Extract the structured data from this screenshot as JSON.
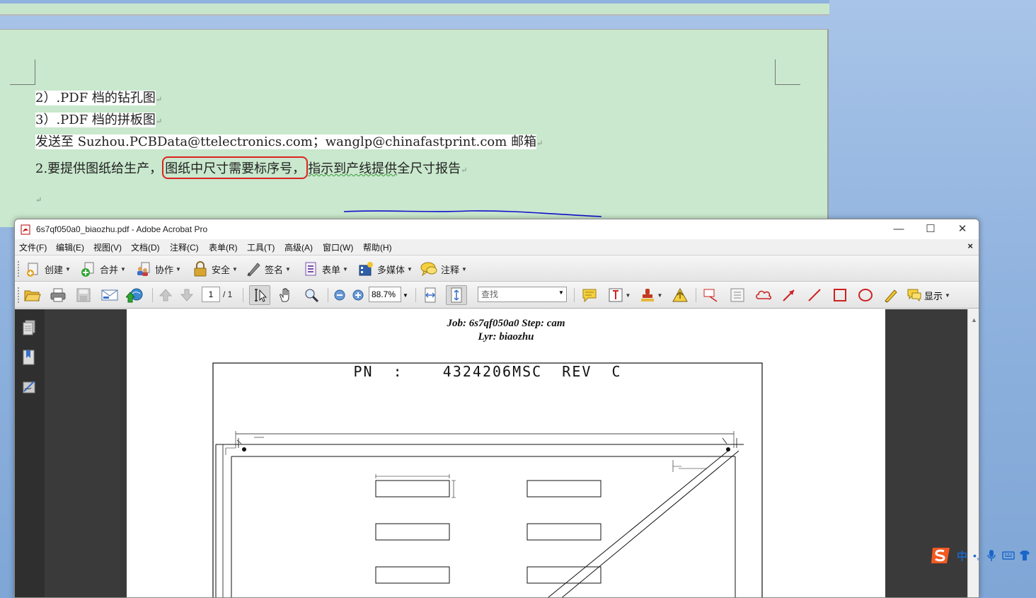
{
  "document": {
    "line1": "2）.PDF 档的钻孔图",
    "line2": "3）.PDF 档的拼板图",
    "line3": "发送至 Suzhou.PCBData@ttelectronics.com；wanglp@chinafastprint.com 邮箱",
    "line4_prefix": "2.要提供图纸给生产，",
    "line4_circled": "图纸中尺寸需要标序号，",
    "line4_underlined": "指示到产线提供",
    "line4_rest": "全尺寸报告",
    "paragraph_mark": "↵"
  },
  "acrobat": {
    "title": "6s7qf050a0_biaozhu.pdf - Adobe Acrobat Pro",
    "window_controls": {
      "minimize": "—",
      "maximize": "☐",
      "close": "✕"
    },
    "menu": [
      "文件(F)",
      "编辑(E)",
      "视图(V)",
      "文档(D)",
      "注释(C)",
      "表单(R)",
      "工具(T)",
      "高级(A)",
      "窗口(W)",
      "帮助(H)"
    ],
    "menu_close": "×",
    "toolbar1": [
      "创建",
      "合并",
      "协作",
      "安全",
      "签名",
      "表单",
      "多媒体",
      "注释"
    ],
    "toolbar2": {
      "page_current": "1",
      "page_total": "/ 1",
      "zoom": "88.7%",
      "find_placeholder": "查找",
      "show_label": "显示"
    }
  },
  "pdf_page": {
    "job_line": "Job: 6s7qf050a0  Step: cam",
    "lyr_line": "Lyr: biaozhu",
    "pn_line": "PN  :    4324206MSC  REV  C"
  },
  "ime": {
    "lang": "中",
    "punct": "•,"
  },
  "colors": {
    "word_bg": "#c9e8cd",
    "annotation_red": "#dd2222",
    "annotation_blue": "#1010cc",
    "desktop_blue": "#8fb2de"
  }
}
